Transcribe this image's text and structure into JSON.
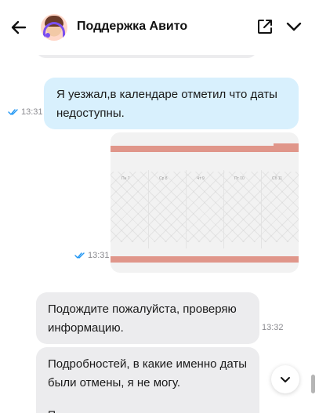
{
  "header": {
    "title": "Поддержка Авито",
    "icons": {
      "back": "arrow-left-icon",
      "avatar": "support-agent-avatar",
      "external": "open-external-icon",
      "menu": "chevron-down-icon"
    }
  },
  "messages": [
    {
      "id": "out-1",
      "direction": "outgoing",
      "text": "Я уезжал,в календаре отметил что даты недоступны.",
      "time": "13:31",
      "status": "read"
    },
    {
      "id": "out-2",
      "direction": "outgoing",
      "type": "image",
      "time": "13:31",
      "status": "read",
      "image_labels": [
        "Пн 7",
        "Ср 8",
        "Чт 9",
        "Пт 10",
        "Сб 11"
      ]
    },
    {
      "id": "in-1",
      "direction": "incoming",
      "text": "Подождите пожалуйста, проверяю информацию.",
      "time": "13:32"
    },
    {
      "id": "in-2",
      "direction": "incoming",
      "text": "Подробностей, в какие именно даты были отмены, я не могу.",
      "text_more": "П..."
    }
  ],
  "colors": {
    "outgoing_bubble": "#d8f0fd",
    "incoming_bubble": "#ececee",
    "read_ticks": "#2196f3",
    "calendar_band": "#e0968a"
  },
  "controls": {
    "scroll_down": "chevron-down-icon"
  }
}
